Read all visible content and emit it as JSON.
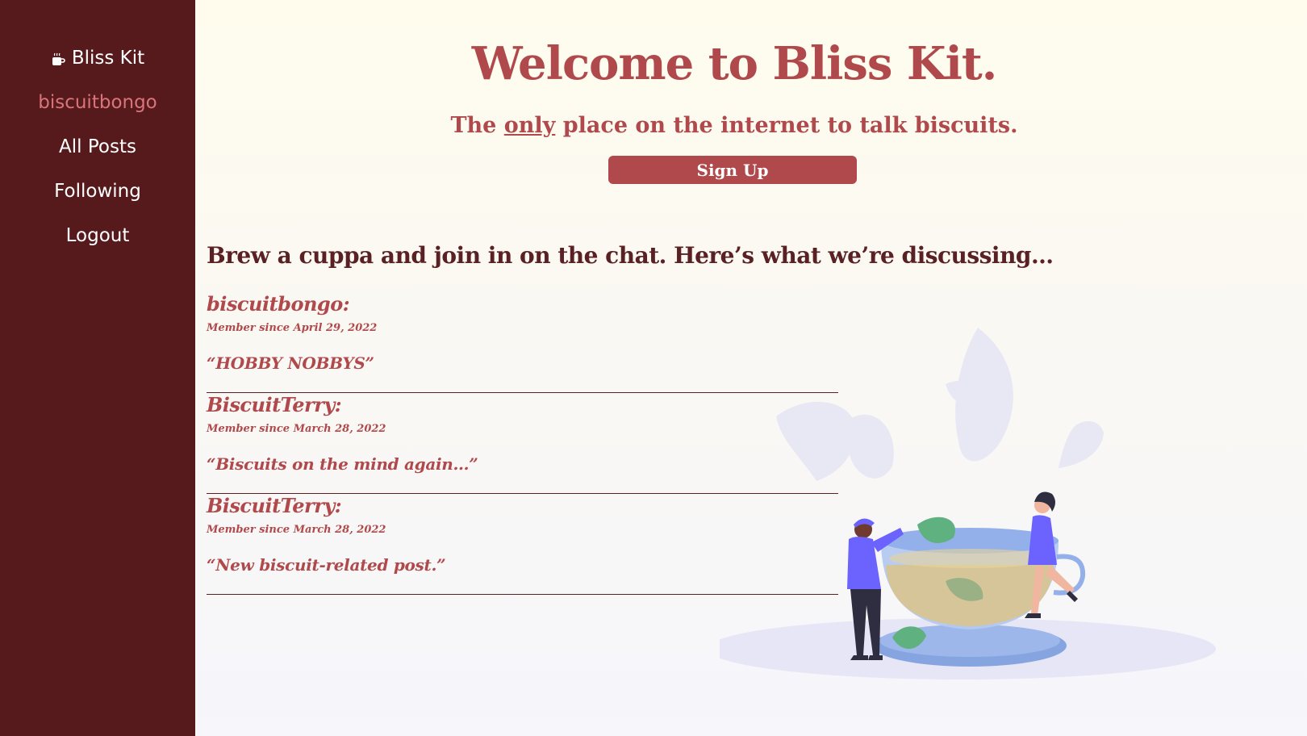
{
  "sidebar": {
    "brand_icon": "coffee-cup-icon",
    "brand_name": "Bliss Kit",
    "username": "biscuitbongo",
    "items": [
      {
        "label": "All Posts"
      },
      {
        "label": "Following"
      },
      {
        "label": "Logout"
      }
    ]
  },
  "hero": {
    "title": "Welcome to Bliss Kit.",
    "subtitle_pre": "The ",
    "subtitle_emph": "only",
    "subtitle_post": " place on the internet to talk biscuits.",
    "signup_label": "Sign Up"
  },
  "feed": {
    "heading": "Brew a cuppa and join in on the chat. Here’s what we’re discussing…",
    "posts": [
      {
        "author": "biscuitbongo:",
        "member_since": "Member since April 29, 2022",
        "title": "“HOBBY NOBBYS”"
      },
      {
        "author": "BiscuitTerry:",
        "member_since": "Member since March 28, 2022",
        "title": "“Biscuits on the mind again…”"
      },
      {
        "author": "BiscuitTerry:",
        "member_since": "Member since March 28, 2022",
        "title": "“New biscuit-related post.”"
      }
    ]
  },
  "colors": {
    "sidebar_bg": "#561a1d",
    "accent": "#b0494b",
    "username": "#d9757a",
    "heading": "#5a2125"
  },
  "illustration": {
    "icon": "tea-cup-people-illustration"
  }
}
